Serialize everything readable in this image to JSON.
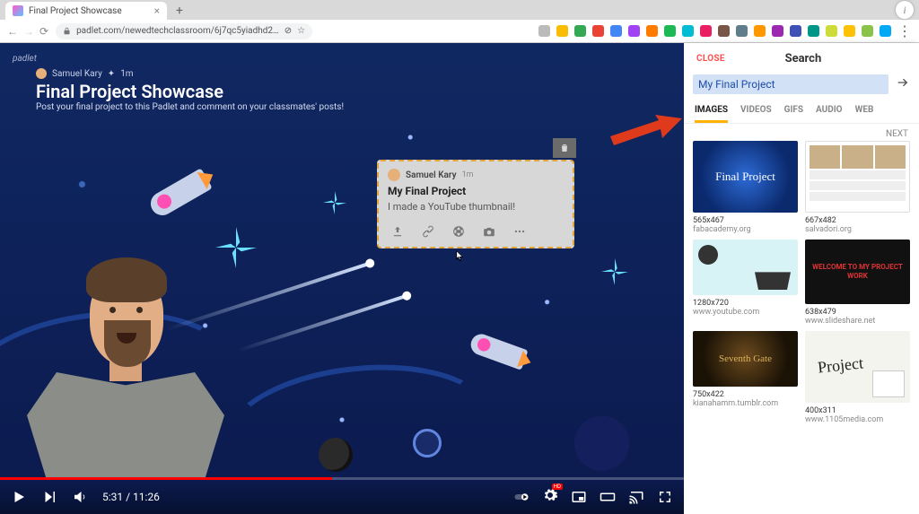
{
  "browser": {
    "tab_title": "Final Project Showcase",
    "url": "padlet.com/newedtechclassroom/6j7qc5yiadhd2…"
  },
  "padlet": {
    "brand": "padlet",
    "byline_author": "Samuel Kary",
    "byline_time": "1m",
    "title": "Final Project Showcase",
    "subtitle": "Post your final project to this Padlet and comment on your classmates' posts!"
  },
  "post": {
    "author": "Samuel Kary",
    "time": "1m",
    "title": "My Final Project",
    "body": "I made a YouTube thumbnail!"
  },
  "player": {
    "current_time": "5:31",
    "duration": "11:26",
    "hd_label": "HD"
  },
  "search": {
    "close_label": "CLOSE",
    "title": "Search",
    "query": "My Final Project",
    "tabs": {
      "images": "IMAGES",
      "videos": "VIDEOS",
      "gifs": "GIFS",
      "audio": "AUDIO",
      "web": "WEB"
    },
    "next_label": "NEXT",
    "results": [
      {
        "dim": "565x467",
        "source": "fabacademy.org"
      },
      {
        "dim": "667x482",
        "source": "salvadori.org"
      },
      {
        "dim": "1280x720",
        "source": "www.youtube.com"
      },
      {
        "dim": "638x479",
        "source": "www.slideshare.net",
        "caption": "WELCOME TO MY PROJECT WORK"
      },
      {
        "dim": "750x422",
        "source": "kianahamm.tumblr.com",
        "caption": "Seventh Gate"
      },
      {
        "dim": "400x311",
        "source": "www.1105media.com"
      }
    ]
  }
}
